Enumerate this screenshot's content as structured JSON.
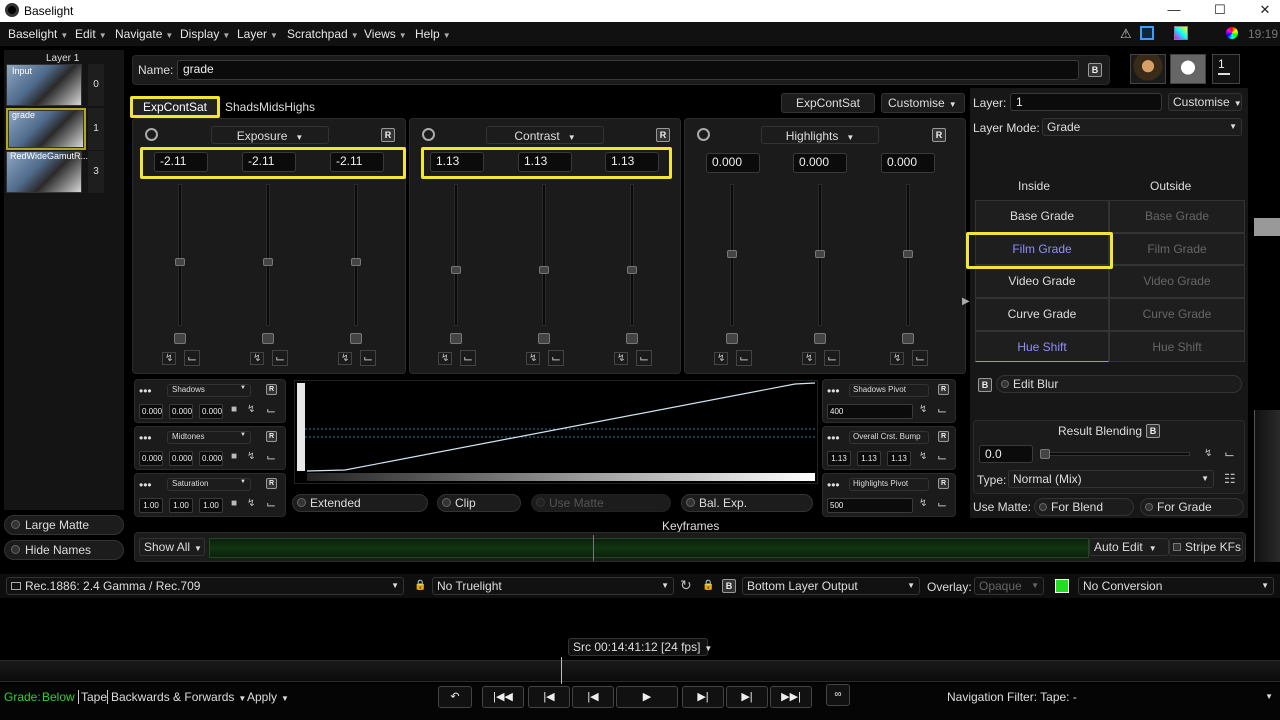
{
  "window": {
    "title": "Baselight"
  },
  "menu": {
    "items": [
      "Baselight",
      "Edit",
      "Navigate",
      "Display",
      "Layer",
      "Scratchpad",
      "Views",
      "Help"
    ],
    "time": "19:19"
  },
  "layers": {
    "title": "Layer 1",
    "items": [
      {
        "name": "Input",
        "num": "0"
      },
      {
        "name": "grade",
        "num": "1"
      },
      {
        "name": "RedWideGamutR...",
        "num": "3"
      }
    ]
  },
  "left": {
    "large_matte": "Large Matte",
    "hide_names": "Hide Names"
  },
  "name": {
    "label": "Name:",
    "value": "grade",
    "b": "B"
  },
  "tabs": {
    "tab1": "ExpContSat",
    "tab2": "ShadsMidsHighs",
    "preset": "ExpContSat",
    "customise": "Customise"
  },
  "exposure": {
    "title": "Exposure",
    "r": "R",
    "values": [
      "-2.11",
      "-2.11",
      "-2.11"
    ]
  },
  "contrast": {
    "title": "Contrast",
    "r": "R",
    "values": [
      "1.13",
      "1.13",
      "1.13"
    ]
  },
  "highlights": {
    "title": "Highlights",
    "r": "R",
    "values": [
      "0.000",
      "0.000",
      "0.000"
    ]
  },
  "shadows": {
    "title": "Shadows",
    "r": "R",
    "values": [
      "0.000",
      "0.000",
      "0.000"
    ]
  },
  "midtones": {
    "title": "Midtones",
    "r": "R",
    "values": [
      "0.000",
      "0.000",
      "0.000"
    ]
  },
  "saturation": {
    "title": "Saturation",
    "r": "R",
    "values": [
      "1.00",
      "1.00",
      "1.00"
    ]
  },
  "pivots": {
    "shadows_title": "Shadows Pivot",
    "shadows_value": "400",
    "crst_title": "Overall Crst. Bump",
    "crst_values": [
      "1.13",
      "1.13",
      "1.13"
    ],
    "high_title": "Highlights Pivot",
    "high_value": "500",
    "r": "R"
  },
  "options": {
    "extended": "Extended",
    "clip": "Clip",
    "use_matte": "Use Matte",
    "bal_exp": "Bal. Exp."
  },
  "keyframes": {
    "title": "Keyframes",
    "show_all": "Show All",
    "auto_edit": "Auto Edit",
    "stripe": "Stripe KFs"
  },
  "right": {
    "layer_label": "Layer:",
    "layer_value": "1",
    "customise": "Customise",
    "mode_label": "Layer Mode:",
    "mode_value": "Grade",
    "inside": "Inside",
    "outside": "Outside",
    "grades": [
      "Base Grade",
      "Film Grade",
      "Video Grade",
      "Curve Grade",
      "Hue Shift"
    ],
    "edit_blur": "Edit Blur",
    "b": "B",
    "result_blending": "Result Blending",
    "blend_value": "0.0",
    "type_label": "Type:",
    "type_value": "Normal (Mix)",
    "use_matte": "Use Matte:",
    "for_blend": "For Blend",
    "for_grade": "For Grade",
    "layer_count": "1"
  },
  "viewer": {
    "colorspace": "Rec.1886: 2.4 Gamma / Rec.709",
    "truelight": "No Truelight",
    "output": "Bottom Layer Output",
    "overlay_label": "Overlay:",
    "overlay_value": "Opaque",
    "conversion": "No Conversion",
    "b": "B"
  },
  "timeline": {
    "src": "Src 00:14:41:12 [24 fps]"
  },
  "transport": {
    "grade_label": "Grade:",
    "grade_value": "Below",
    "tape": "Tape",
    "direction": "Backwards & Forwards",
    "apply": "Apply",
    "nav_filter": "Navigation Filter: Tape: -"
  },
  "colors": {
    "accent": "#f2e633",
    "hue_shift": "#8f8fff",
    "film_grade": "#8f8fff",
    "green": "#22dd22"
  }
}
